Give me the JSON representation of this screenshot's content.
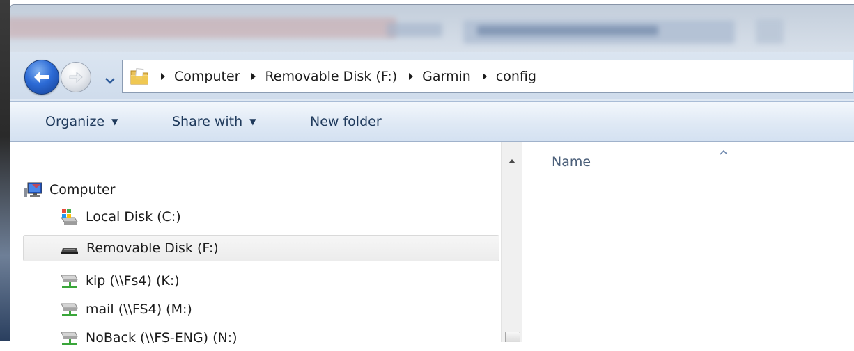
{
  "address_bar": {
    "breadcrumbs": [
      "Computer",
      "Removable Disk (F:)",
      "Garmin",
      "config"
    ]
  },
  "command_bar": {
    "organize": "Organize",
    "share_with": "Share with",
    "new_folder": "New folder"
  },
  "navigation_pane": {
    "computer": "Computer",
    "drives": [
      {
        "label": "Local Disk (C:)",
        "icon": "local-disk-icon"
      },
      {
        "label": "Removable Disk (F:)",
        "icon": "removable-disk-icon",
        "selected": true
      },
      {
        "label": "kip (\\\\Fs4) (K:)",
        "icon": "network-drive-icon"
      },
      {
        "label": "mail (\\\\FS4) (M:)",
        "icon": "network-drive-icon"
      },
      {
        "label": "NoBack (\\\\FS-ENG) (N:)",
        "icon": "network-drive-icon"
      }
    ]
  },
  "file_list": {
    "column_name": "Name"
  },
  "colors": {
    "accent": "#1e395b",
    "selection": "#ececec"
  }
}
